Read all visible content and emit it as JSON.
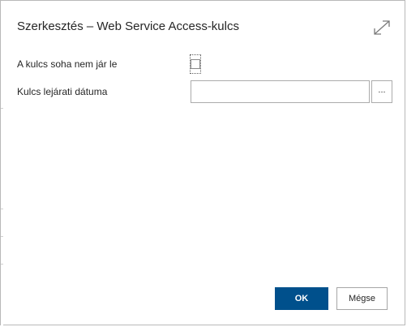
{
  "dialog": {
    "title": "Szerkesztés – Web Service Access-kulcs",
    "expand_icon": "expand-diagonal-icon"
  },
  "fields": {
    "never_expires": {
      "label": "A kulcs soha nem jár le",
      "checked": false
    },
    "expiry_date": {
      "label": "Kulcs lejárati dátuma",
      "value": "",
      "lookup_label": "..."
    }
  },
  "buttons": {
    "ok_label": "OK",
    "cancel_label": "Mégse"
  },
  "colors": {
    "primary": "#00508c",
    "border": "#ababab",
    "text": "#262626"
  }
}
